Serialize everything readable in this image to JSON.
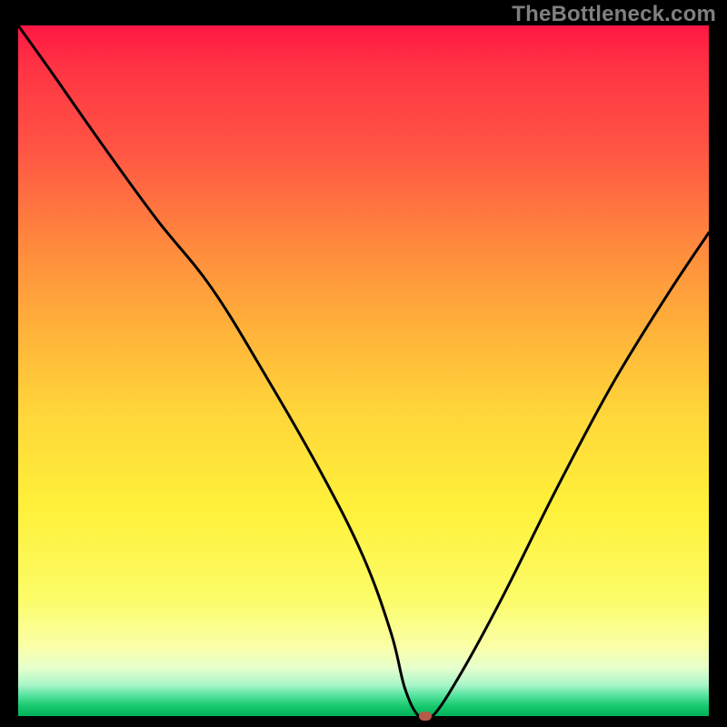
{
  "watermark": "TheBottleneck.com",
  "colors": {
    "frame": "#000000",
    "watermark": "#808080",
    "curve": "#000000",
    "marker": "#b85a4a"
  },
  "chart_data": {
    "type": "line",
    "title": "",
    "xlabel": "",
    "ylabel": "",
    "xlim": [
      0,
      100
    ],
    "ylim": [
      0,
      100
    ],
    "gradient_stops": [
      {
        "pos": 0,
        "color": "#ff1744"
      },
      {
        "pos": 18,
        "color": "#ff5544"
      },
      {
        "pos": 44,
        "color": "#ffb23a"
      },
      {
        "pos": 70,
        "color": "#fff13a"
      },
      {
        "pos": 90,
        "color": "#faffa8"
      },
      {
        "pos": 97,
        "color": "#56e39f"
      },
      {
        "pos": 100,
        "color": "#00b159"
      }
    ],
    "series": [
      {
        "name": "bottleneck-curve",
        "x": [
          0,
          5,
          12,
          20,
          28,
          36,
          44,
          50,
          54,
          56,
          58,
          60,
          64,
          70,
          78,
          86,
          94,
          100
        ],
        "values": [
          100,
          93,
          83,
          72,
          62,
          49,
          35,
          23,
          12,
          4,
          0,
          0,
          6,
          17,
          33,
          48,
          61,
          70
        ]
      }
    ],
    "marker": {
      "x": 59,
      "y": 0
    },
    "flat_bottom": {
      "x_start": 55,
      "x_end": 60,
      "y": 0
    }
  }
}
